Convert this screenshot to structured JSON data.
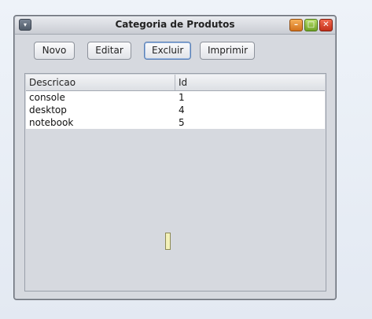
{
  "window": {
    "title": "Categoria de Produtos",
    "sysmenu_icon": "▾",
    "min_icon": "–",
    "max_icon": "□",
    "close_icon": "✕"
  },
  "toolbar": {
    "novo_label": "Novo",
    "editar_label": "Editar",
    "excluir_label": "Excluir",
    "imprimir_label": "Imprimir"
  },
  "table": {
    "columns": [
      "Descricao",
      "Id"
    ],
    "rows": [
      [
        "console",
        "1"
      ],
      [
        "desktop",
        "4"
      ],
      [
        "notebook",
        "5"
      ]
    ]
  }
}
